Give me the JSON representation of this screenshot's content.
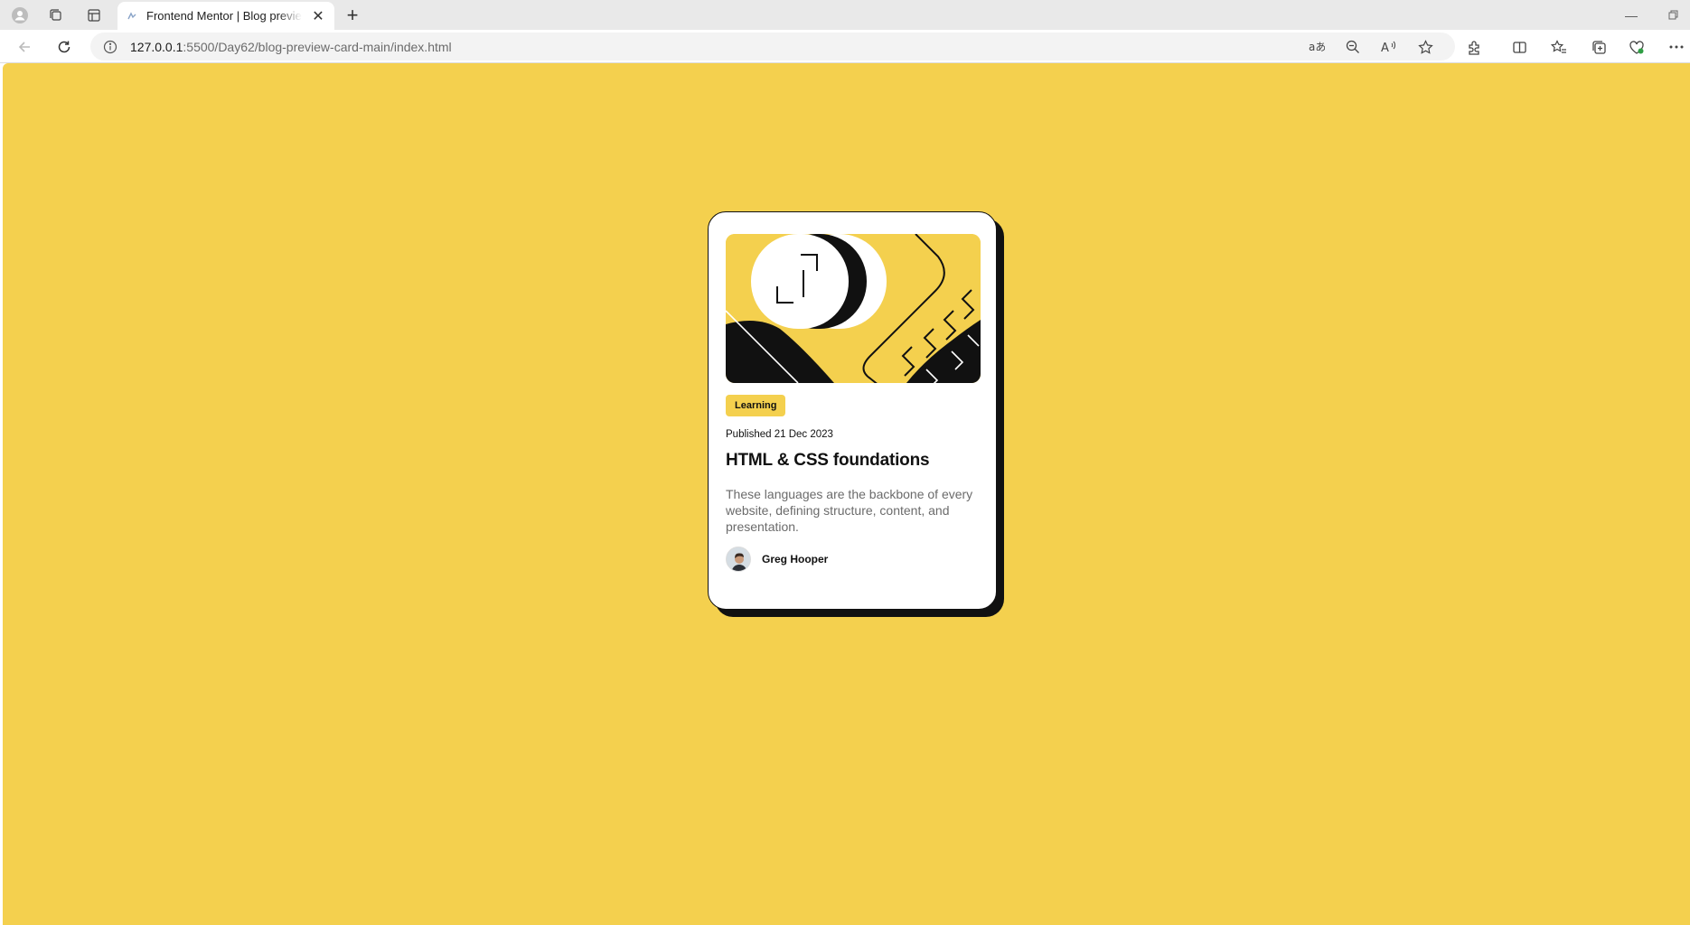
{
  "browser": {
    "tab_title": "Frontend Mentor | Blog preview card",
    "url_host": "127.0.0.1",
    "url_rest": ":5500/Day62/blog-preview-card-main/index.html"
  },
  "card": {
    "tag": "Learning",
    "published": "Published 21 Dec 2023",
    "title": "HTML & CSS foundations",
    "description": "These languages are the backbone of every website, defining structure, content, and presentation.",
    "author": "Greg Hooper"
  },
  "colors": {
    "page_background": "#f4d04e",
    "card_background": "#ffffff",
    "ink": "#111111",
    "muted_text": "#6b6b6b"
  }
}
